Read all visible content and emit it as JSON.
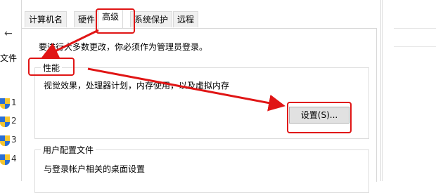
{
  "background": {
    "back_arrow": "←",
    "file_label": "文件",
    "side_letters": [
      "1",
      "2",
      "3",
      "4"
    ]
  },
  "dialog": {
    "tabs": [
      {
        "label": "计算机名",
        "active": false
      },
      {
        "label": "硬件",
        "active": false
      },
      {
        "label": "高级",
        "active": true
      },
      {
        "label": "系统保护",
        "active": false
      },
      {
        "label": "远程",
        "active": false
      }
    ],
    "admin_note": "要进行大多数更改，你必须作为管理员登录。",
    "performance": {
      "title": "性能",
      "description": "视觉效果，处理器计划，内存使用，以及虚拟内存",
      "settings_button": "设置(S)..."
    },
    "user_profiles": {
      "title": "用户配置文件",
      "description": "与登录帐户相关的桌面设置"
    }
  },
  "annotation": {
    "color": "#e01515"
  }
}
